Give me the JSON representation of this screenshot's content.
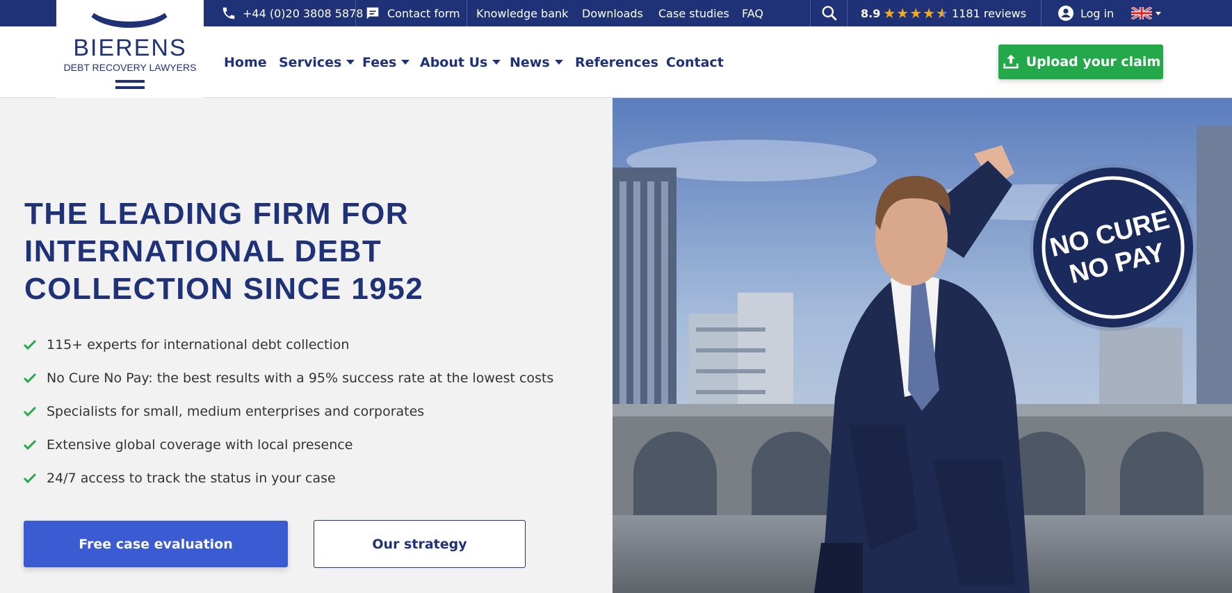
{
  "topbar": {
    "phone": "+44 (0)20 3808 5878",
    "contact_form": "Contact form",
    "links": [
      "Knowledge bank",
      "Downloads",
      "Case studies",
      "FAQ"
    ],
    "rating_score": "8.9",
    "stars": 4.5,
    "reviews": "1181 reviews",
    "login": "Log in"
  },
  "logo": {
    "name": "BIERENS",
    "tagline": "DEBT RECOVERY LAWYERS"
  },
  "nav": {
    "items": [
      "Home",
      "Services",
      "Fees",
      "About Us",
      "News",
      "References",
      "Contact"
    ],
    "upload_label": "Upload your claim"
  },
  "hero": {
    "headline_lines": [
      "THE LEADING FIRM FOR",
      "INTERNATIONAL DEBT",
      "COLLECTION SINCE 1952"
    ],
    "bullets": [
      "115+ experts for international debt collection",
      "No Cure No Pay: the best results with a 95% success rate at the lowest costs",
      "Specialists for small, medium enterprises and corporates",
      "Extensive global coverage with local presence",
      "24/7 access to track the status in your case"
    ],
    "cta_primary": "Free case evaluation",
    "cta_secondary": "Our strategy",
    "badge_lines": [
      "NO CURE",
      "NO PAY"
    ]
  },
  "colors": {
    "navy": "#1f3278",
    "green": "#23a84a",
    "blue_button": "#3a5bd2",
    "star": "#f2a91c"
  }
}
